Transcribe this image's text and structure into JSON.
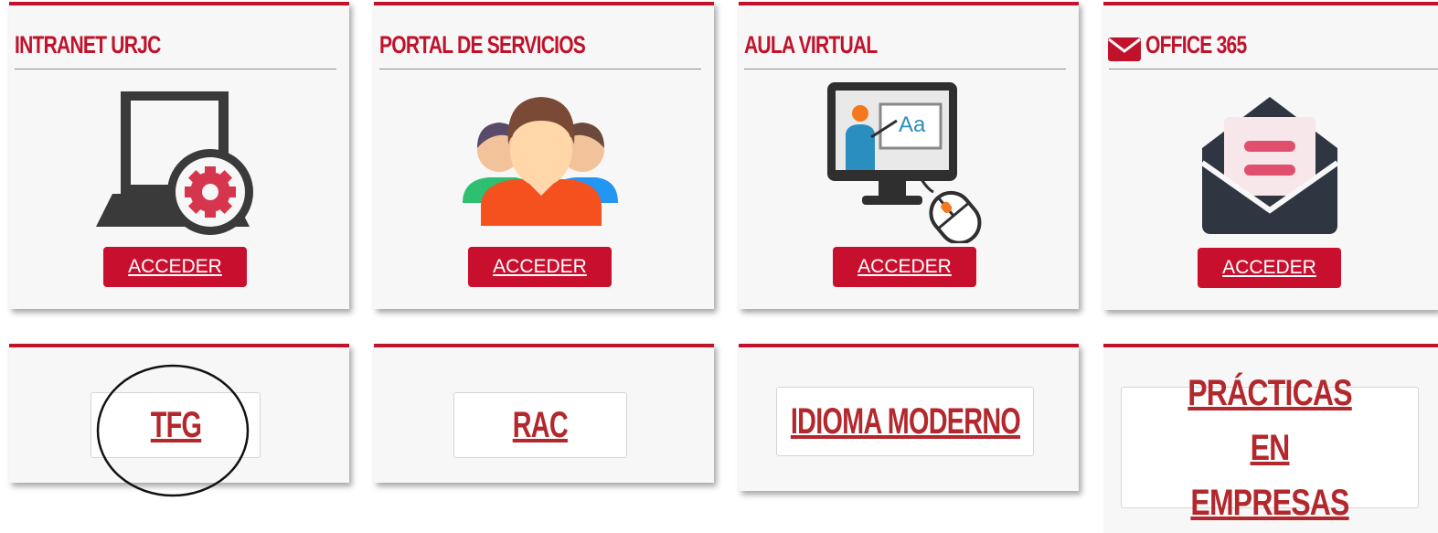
{
  "cards": [
    {
      "title": "INTRANET URJC",
      "icon": "laptop-gear-icon",
      "button": "ACCEDER"
    },
    {
      "title": "PORTAL DE SERVICIOS",
      "icon": "people-group-icon",
      "button": "ACCEDER"
    },
    {
      "title": "AULA VIRTUAL",
      "icon": "virtual-classroom-icon",
      "button": "ACCEDER"
    },
    {
      "title": "OFFICE 365",
      "title_icon": "envelope-icon",
      "icon": "open-mail-icon",
      "button": "ACCEDER"
    }
  ],
  "links": [
    {
      "label": "TFG"
    },
    {
      "label": "RAC"
    },
    {
      "label": "IDIOMA MODERNO"
    },
    {
      "label": "PRÁCTICAS EN EMPRESAS"
    }
  ],
  "colors": {
    "accent": "#c0122a",
    "button": "#c8102e",
    "link": "#b3282d",
    "card_bg": "#f7f7f7"
  }
}
